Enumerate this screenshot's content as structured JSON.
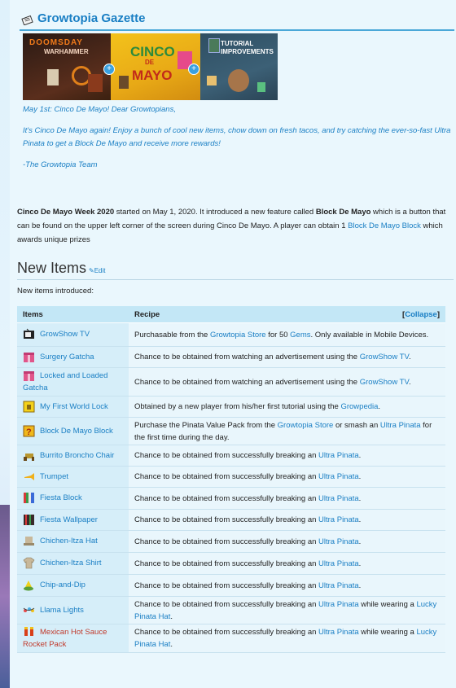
{
  "gazette": {
    "title": "Growtopia Gazette"
  },
  "banner": {
    "panel1_title": "DOOMSDAY",
    "panel1_sub": "WARHAMMER",
    "panel2_line1": "CINCO",
    "panel2_line2": "DE",
    "panel2_line3": "MAYO",
    "panel3_line1": "TUTORIAL",
    "panel3_line2": "IMPROVEMENTS"
  },
  "intro": {
    "line1": "May 1st: Cinco De Mayo! Dear Growtopians,",
    "line2": "It's Cinco De Mayo again! Enjoy a bunch of cool new items, chow down on fresh tacos, and try catching the ever-so-fast Ultra Pinata to get a Block De Mayo and receive more rewards!",
    "line3": "-The Growtopia Team"
  },
  "body": {
    "week_bold": "Cinco De Mayo Week 2020",
    "text1": " started on May 1, 2020. It introduced a new feature called ",
    "feature_bold": "Block De Mayo",
    "text2": " which is a button that can be found on the upper left corner of the screen during Cinco De Mayo. A player can obtain 1 ",
    "link": "Block De Mayo Block",
    "text3": " which awards unique prizes"
  },
  "section": {
    "title": "New Items",
    "edit_label": "Edit",
    "note": "New items introduced:"
  },
  "table": {
    "col_items": "Items",
    "col_recipe": "Recipe",
    "collapse_label": "Collapse",
    "rows": [
      {
        "name": "GrowShow TV",
        "icon": "tv-icon",
        "recipe": [
          {
            "t": "Purchasable from the "
          },
          {
            "l": "Growtopia Store"
          },
          {
            "t": " for 50 "
          },
          {
            "l": "Gems"
          },
          {
            "t": ". Only available in Mobile Devices."
          }
        ]
      },
      {
        "name": "Surgery Gatcha",
        "icon": "gift-box-icon",
        "recipe": [
          {
            "t": "Chance to be obtained from watching an advertisement using the "
          },
          {
            "l": "GrowShow TV"
          },
          {
            "t": "."
          }
        ]
      },
      {
        "name": "Locked and Loaded Gatcha",
        "icon": "gift-box-icon",
        "recipe": [
          {
            "t": "Chance to be obtained from watching an advertisement using the "
          },
          {
            "l": "GrowShow TV"
          },
          {
            "t": "."
          }
        ]
      },
      {
        "name": "My First World Lock",
        "icon": "lock-icon",
        "recipe": [
          {
            "t": "Obtained by a new player from his/her first tutorial using the "
          },
          {
            "l": "Growpedia"
          },
          {
            "t": "."
          }
        ]
      },
      {
        "name": "Block De Mayo Block",
        "icon": "question-block-icon",
        "recipe": [
          {
            "t": "Purchase the Pinata Value Pack from the "
          },
          {
            "l": "Growtopia Store"
          },
          {
            "t": " or smash an "
          },
          {
            "l": "Ultra Pinata"
          },
          {
            "t": " for the first time during the day."
          }
        ]
      },
      {
        "name": "Burrito Broncho Chair",
        "icon": "chair-icon",
        "recipe": [
          {
            "t": "Chance to be obtained from successfully breaking an "
          },
          {
            "l": "Ultra Pinata"
          },
          {
            "t": "."
          }
        ]
      },
      {
        "name": "Trumpet",
        "icon": "trumpet-icon",
        "recipe": [
          {
            "t": "Chance to be obtained from successfully breaking an "
          },
          {
            "l": "Ultra Pinata"
          },
          {
            "t": "."
          }
        ]
      },
      {
        "name": "Fiesta Block",
        "icon": "striped-block-icon",
        "recipe": [
          {
            "t": "Chance to be obtained from successfully breaking an "
          },
          {
            "l": "Ultra Pinata"
          },
          {
            "t": "."
          }
        ]
      },
      {
        "name": "Fiesta Wallpaper",
        "icon": "striped-wallpaper-icon",
        "recipe": [
          {
            "t": "Chance to be obtained from successfully breaking an "
          },
          {
            "l": "Ultra Pinata"
          },
          {
            "t": "."
          }
        ]
      },
      {
        "name": "Chichen-Itza Hat",
        "icon": "hat-icon",
        "recipe": [
          {
            "t": "Chance to be obtained from successfully breaking an "
          },
          {
            "l": "Ultra Pinata"
          },
          {
            "t": "."
          }
        ]
      },
      {
        "name": "Chichen-Itza Shirt",
        "icon": "shirt-icon",
        "recipe": [
          {
            "t": "Chance to be obtained from successfully breaking an "
          },
          {
            "l": "Ultra Pinata"
          },
          {
            "t": "."
          }
        ]
      },
      {
        "name": "Chip-and-Dip",
        "icon": "chip-dip-icon",
        "recipe": [
          {
            "t": "Chance to be obtained from successfully breaking an "
          },
          {
            "l": "Ultra Pinata"
          },
          {
            "t": "."
          }
        ]
      },
      {
        "name": "Llama Lights",
        "icon": "llama-lights-icon",
        "recipe": [
          {
            "t": "Chance to be obtained from successfully breaking an "
          },
          {
            "l": "Ultra Pinata"
          },
          {
            "t": " while wearing a "
          },
          {
            "l": "Lucky Pinata Hat"
          },
          {
            "t": "."
          }
        ]
      },
      {
        "name": "Mexican Hot Sauce Rocket Pack",
        "icon": "rocket-pack-icon",
        "name_color": "#c0392b",
        "recipe": [
          {
            "t": "Chance to be obtained from successfully breaking an "
          },
          {
            "l": "Ultra Pinata"
          },
          {
            "t": " while wearing a "
          },
          {
            "l": "Lucky Pinata Hat"
          },
          {
            "t": "."
          }
        ]
      }
    ]
  },
  "colors": {
    "link": "#1a7fc4",
    "header_bg": "#c3e7f6",
    "page_bg": "#eaf7fd"
  }
}
